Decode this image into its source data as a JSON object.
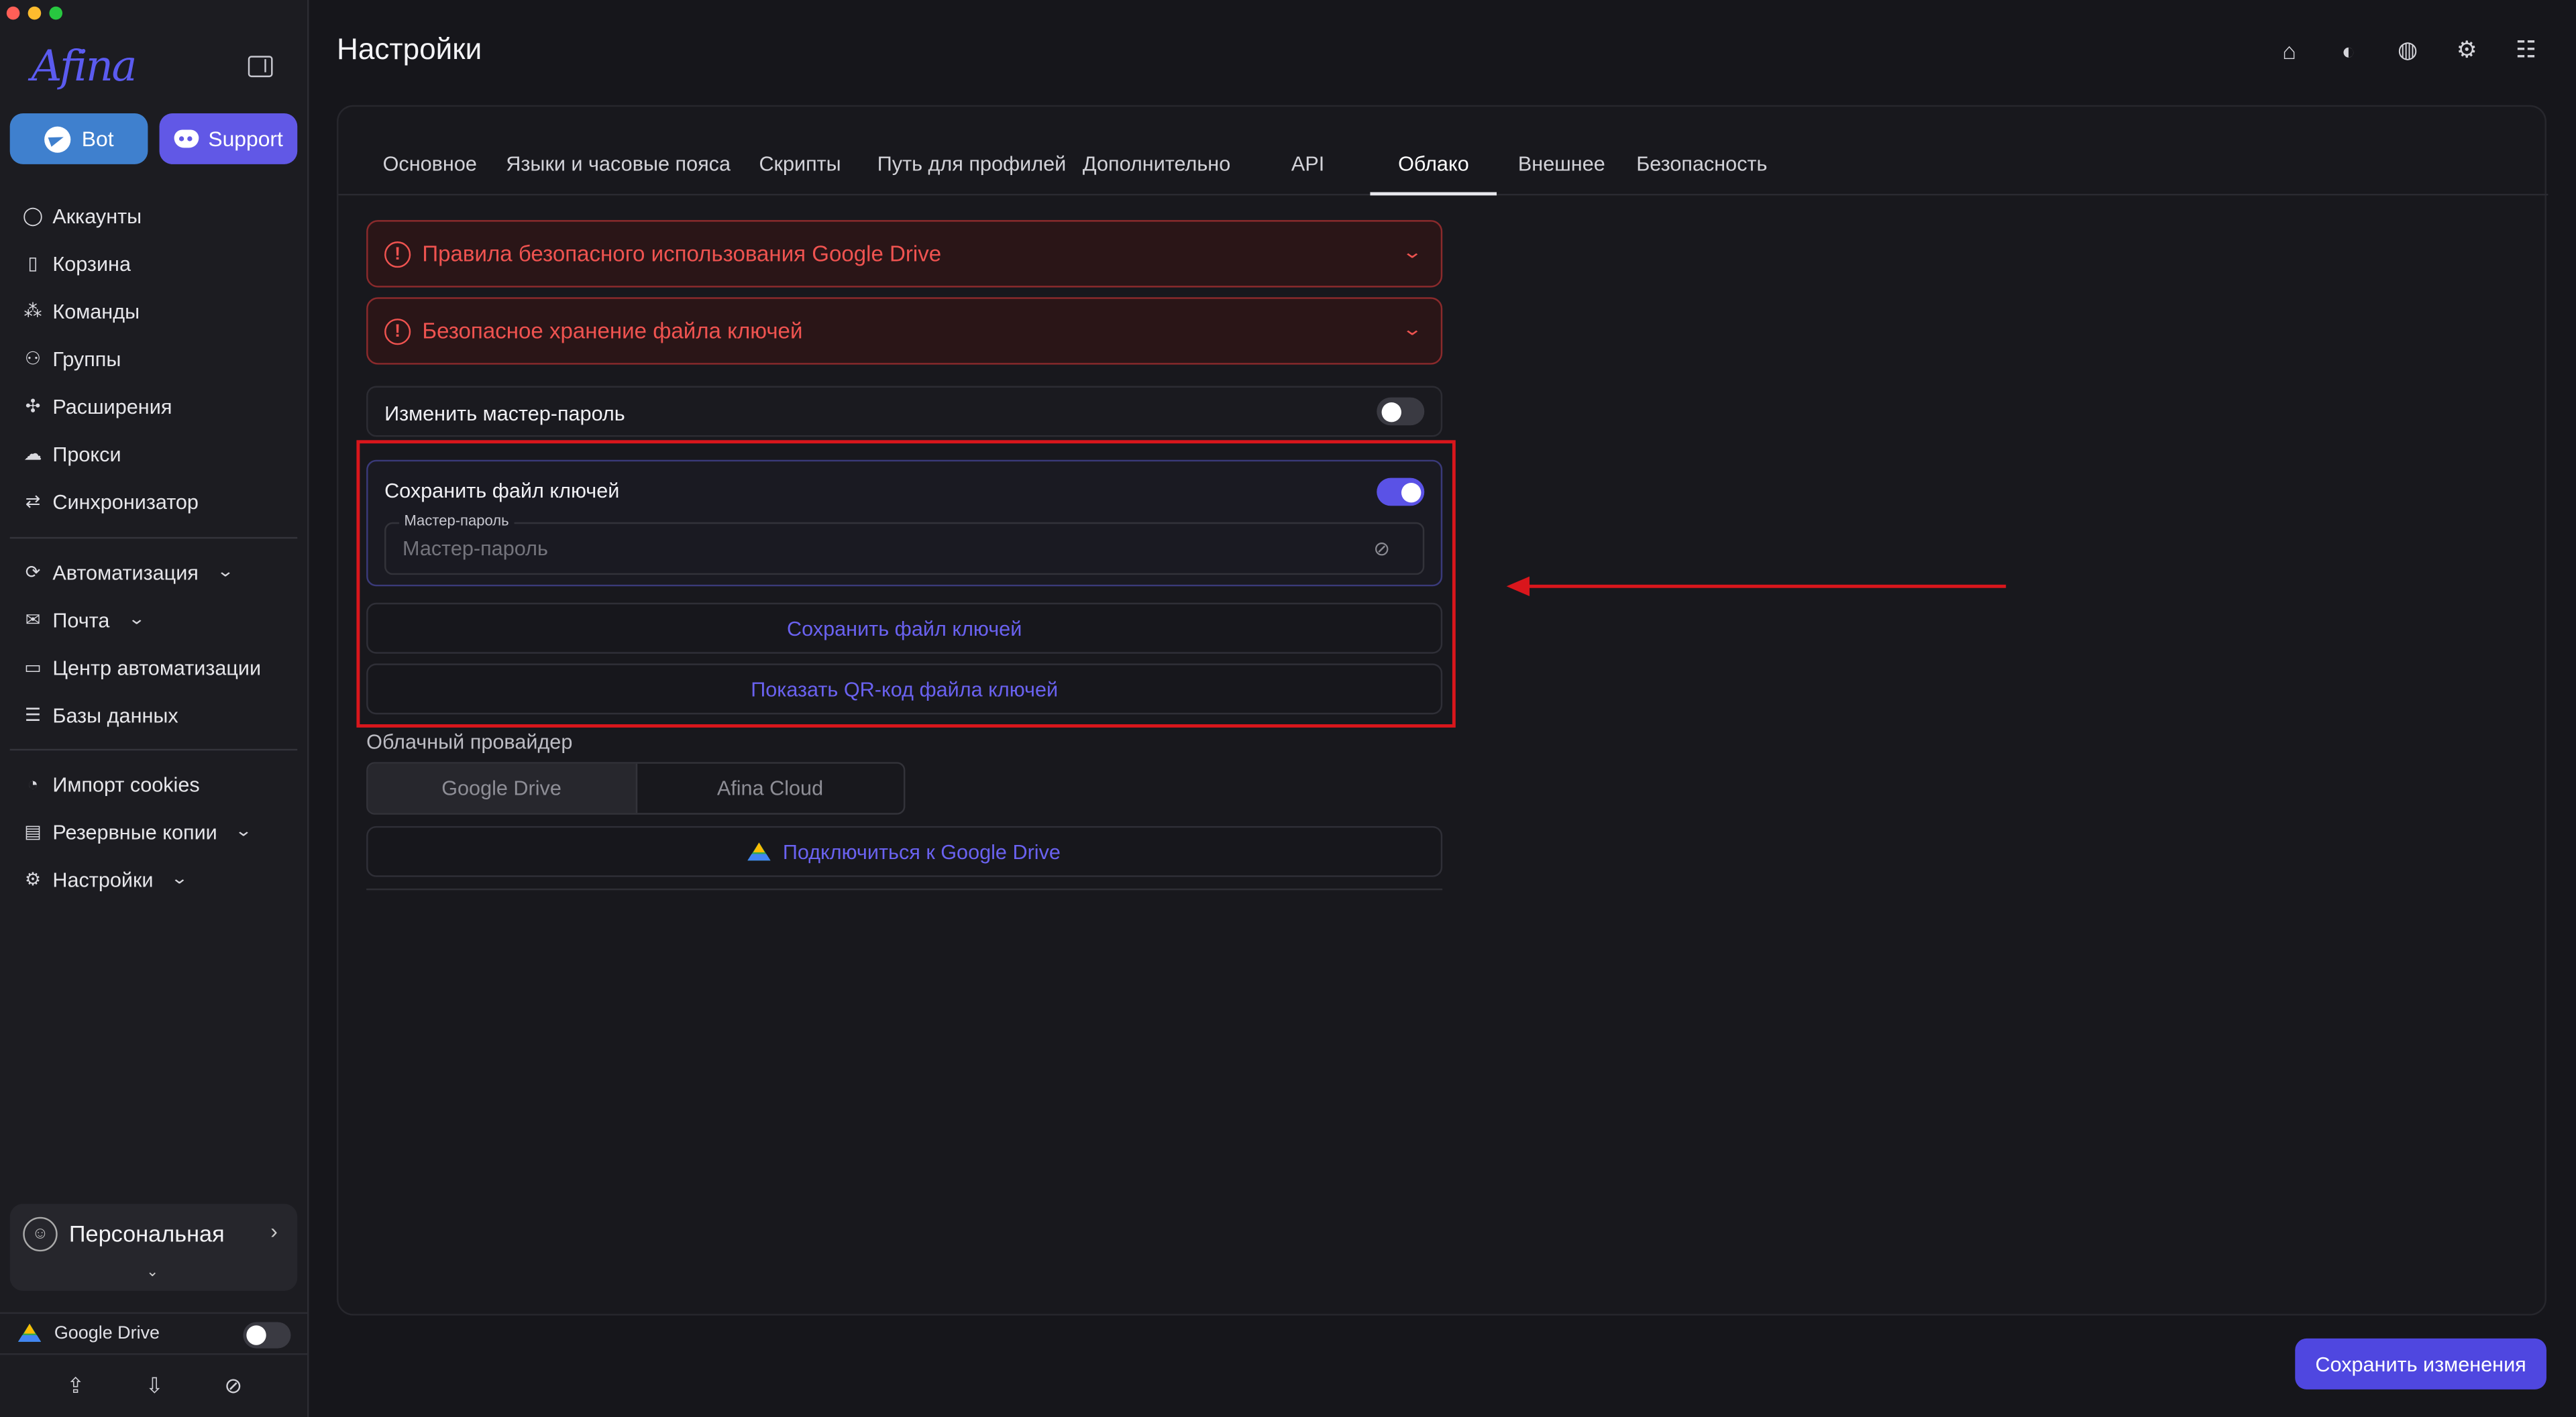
{
  "app": {
    "logo": "Afina",
    "title": "Настройки"
  },
  "sidebar": {
    "bot_label": "Bot",
    "support_label": "Support",
    "group1": [
      {
        "label": "Аккаунты",
        "icon": "user-circle-icon"
      },
      {
        "label": "Корзина",
        "icon": "trash-icon"
      },
      {
        "label": "Команды",
        "icon": "team-icon"
      },
      {
        "label": "Группы",
        "icon": "group-icon"
      },
      {
        "label": "Расширения",
        "icon": "puzzle-icon"
      },
      {
        "label": "Прокси",
        "icon": "cloud-icon"
      },
      {
        "label": "Синхронизатор",
        "icon": "sync-icon"
      }
    ],
    "group2": [
      {
        "label": "Автоматизация",
        "icon": "automation-icon"
      },
      {
        "label": "Почта",
        "icon": "mail-icon"
      },
      {
        "label": "Центр автоматизации",
        "icon": "laptop-icon"
      },
      {
        "label": "Базы данных",
        "icon": "list-icon"
      }
    ],
    "group3": [
      {
        "label": "Импорт cookies",
        "icon": "cookie-icon"
      },
      {
        "label": "Резервные копии",
        "icon": "backup-icon"
      },
      {
        "label": "Настройки",
        "icon": "gear-icon"
      }
    ],
    "profile_name": "Персональная",
    "google_drive_label": "Google Drive"
  },
  "tabs": [
    "Основное",
    "Языки и часовые пояса",
    "Скрипты",
    "Путь для профилей",
    "Дополнительно",
    "API",
    "Облако",
    "Внешнее",
    "Безопасность"
  ],
  "active_tab": "Облако",
  "cloud": {
    "alert1": "Правила безопасного использования Google Drive",
    "alert2": "Безопасное хранение файла ключей",
    "change_master_label": "Изменить мастер-пароль",
    "save_keys_label": "Сохранить файл ключей",
    "master_legend": "Мастер-пароль",
    "master_placeholder": "Мастер-пароль",
    "save_keys_button": "Сохранить файл ключей",
    "show_qr_button": "Показать QR-код файла ключей",
    "provider_label": "Облачный провайдер",
    "provider_options": [
      "Google Drive",
      "Afina Cloud"
    ],
    "provider_selected": "Google Drive",
    "connect_button": "Подключиться к Google Drive"
  },
  "save_changes": "Сохранить изменения",
  "toggles": {
    "change_master": false,
    "save_keys": true,
    "google_drive": false
  },
  "colors": {
    "accent": "#5a52e6",
    "alert": "#ef5350",
    "annotation": "#d9161c",
    "bot": "#3f80ce"
  }
}
